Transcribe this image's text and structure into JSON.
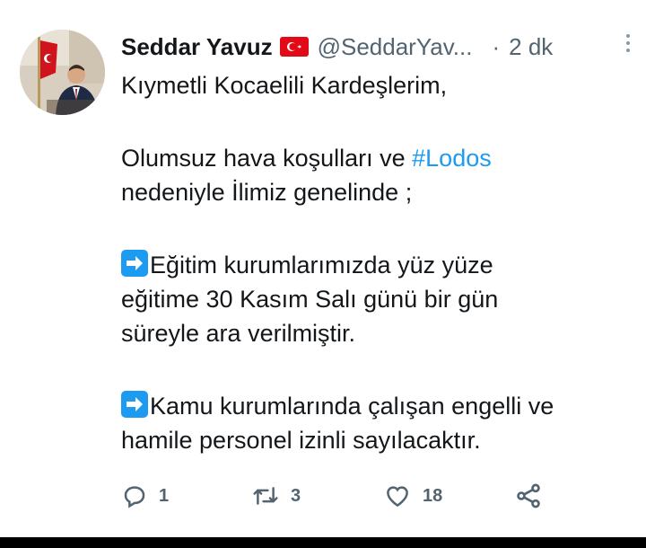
{
  "author": {
    "name": "Seddar Yavuz",
    "handle": "@SeddarYav...",
    "separator": "·",
    "time": "2 dk",
    "flag_color": "#e30a17"
  },
  "tweet": {
    "line1": "Kıymetli Kocaelili Kardeşlerim,",
    "p2_before": "Olumsuz hava koşulları ve ",
    "hashtag": "#Lodos",
    "p2_after": "nedeniyle İlimiz genelinde ;",
    "p3_line1": "Eğitim kurumlarımızda yüz yüze",
    "p3_line2": "eğitime 30 Kasım Salı günü bir gün",
    "p3_line3": "süreyle ara verilmiştir.",
    "p4_line1": "Kamu kurumlarında çalışan engelli ve",
    "p4_line2": "hamile personel izinli sayılacaktır.",
    "hashtag_color": "#1d9bf0"
  },
  "actions": {
    "reply_count": "1",
    "retweet_count": "3",
    "like_count": "18"
  },
  "icons": [
    "avatar",
    "turkish-flag-icon",
    "more-icon",
    "right-arrow-emoji-icon",
    "reply-icon",
    "retweet-icon",
    "like-icon",
    "share-icon"
  ]
}
